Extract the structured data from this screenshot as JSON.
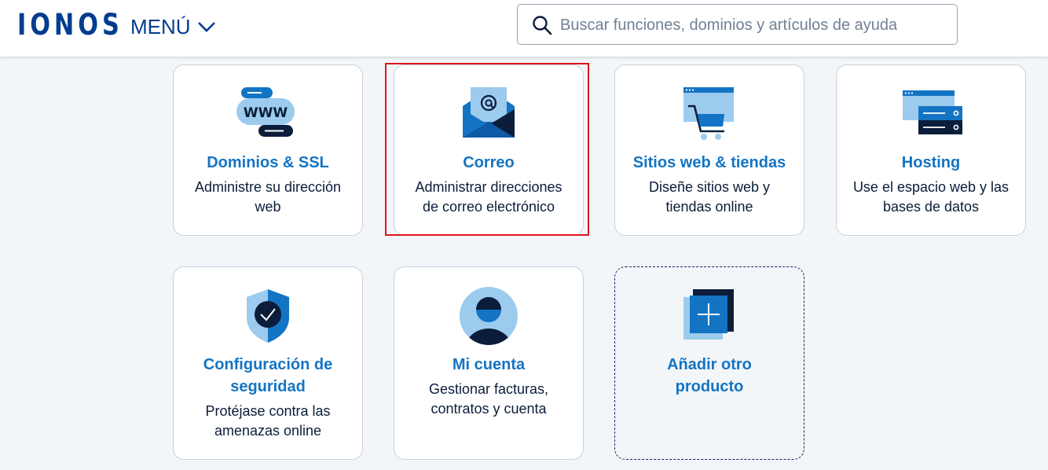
{
  "header": {
    "logo": "IONOS",
    "menu_label": "MENÚ",
    "search_placeholder": "Buscar funciones, dominios y artículos de ayuda"
  },
  "cards": [
    {
      "title": "Dominios & SSL",
      "desc_1": "Administre su dirección",
      "desc_2": "web",
      "icon": "www-domain-icon"
    },
    {
      "title": "Correo",
      "desc_1": "Administrar direcciones",
      "desc_2": "de correo electrónico",
      "icon": "mail-envelope-icon"
    },
    {
      "title": "Sitios web & tiendas",
      "desc_1": "Diseñe sitios web y",
      "desc_2": "tiendas online",
      "icon": "shop-cart-icon"
    },
    {
      "title": "Hosting",
      "desc_1": "Use el espacio web y las",
      "desc_2": "bases de datos",
      "icon": "server-icon"
    },
    {
      "title_1": "Configuración de",
      "title_2": "seguridad",
      "desc_1": "Protéjase contra las",
      "desc_2": "amenazas online",
      "icon": "shield-check-icon"
    },
    {
      "title": "Mi cuenta",
      "desc_1": "Gestionar facturas,",
      "desc_2": "contratos y cuenta",
      "icon": "user-avatar-icon"
    },
    {
      "title_1": "Añadir otro",
      "title_2": "producto",
      "icon": "add-product-icon"
    }
  ],
  "colors": {
    "brand": "#003d8f",
    "title_blue": "#1474c4",
    "highlight_red": "#e0141e"
  }
}
